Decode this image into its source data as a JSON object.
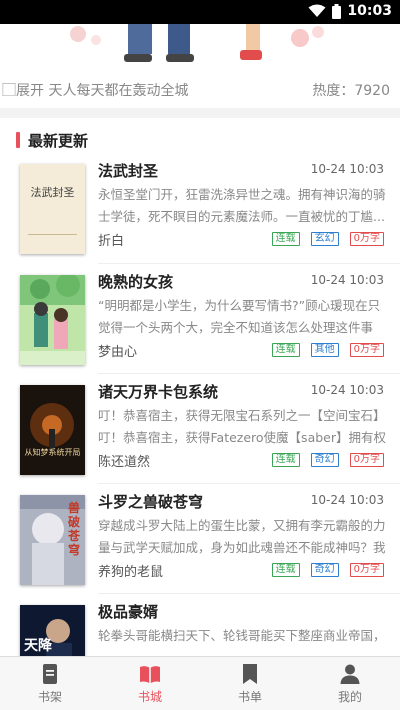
{
  "status": {
    "time": "10:03"
  },
  "banner": {
    "tagline": "⃞展开 天人每天都在轰动全城",
    "heat": "热度：7920"
  },
  "section": {
    "title": "最新更新"
  },
  "books": [
    {
      "title": "法武封圣",
      "time": "10-24 10:03",
      "desc": "永恒圣堂门开，狂雷洗涤异世之魂。拥有神识海的骑士学徒，死不瞑目的元素魔法师。一直被忧的丁尴...",
      "author": "折白",
      "tags": [
        "连载",
        "玄幻",
        "0万字"
      ],
      "cover_text": "法武封圣"
    },
    {
      "title": "晚熟的女孩",
      "time": "10-24 10:03",
      "desc": "“明明都是小学生，为什么要写情书?”顾心瑗现在只觉得一个头两个大，完全不知道该怎么处理这件事情。",
      "author": "梦由心",
      "tags": [
        "连载",
        "其他",
        "0万字"
      ],
      "cover_text": ""
    },
    {
      "title": "诸天万界卡包系统",
      "time": "10-24 10:03",
      "desc": "叮！恭喜宿主，获得无限宝石系列之一【空间宝石】叮！恭喜宿主，获得Fatezero使魔【saber】拥有权",
      "author": "陈还道然",
      "tags": [
        "连载",
        "奇幻",
        "0万字"
      ],
      "cover_text": "从知梦系统开局"
    },
    {
      "title": "斗罗之兽破苍穹",
      "time": "10-24 10:03",
      "desc": "穿越成斗罗大陆上的蛋生比蒙，又拥有李元霸般的力量与武学天赋加成，身为如此魂兽还不能成神吗？我",
      "author": "养狗的老鼠",
      "tags": [
        "连载",
        "奇幻",
        "0万字"
      ],
      "cover_text": "兽破苍穹"
    },
    {
      "title": "极品豪婿",
      "time": "",
      "desc": "轮拳头哥能横扫天下、轮钱哥能买下整座商业帝国，",
      "author": "",
      "tags": [],
      "cover_text": "天降"
    }
  ],
  "tabs": [
    {
      "label": "书架",
      "icon": "bookshelf-icon"
    },
    {
      "label": "书城",
      "icon": "open-book-icon"
    },
    {
      "label": "书单",
      "icon": "bookmark-icon"
    },
    {
      "label": "我的",
      "icon": "user-icon"
    }
  ],
  "colors": {
    "accent": "#e8505b",
    "tag_green": "#3aa655",
    "tag_blue": "#2f7fd1",
    "tag_red": "#e24c4c"
  }
}
